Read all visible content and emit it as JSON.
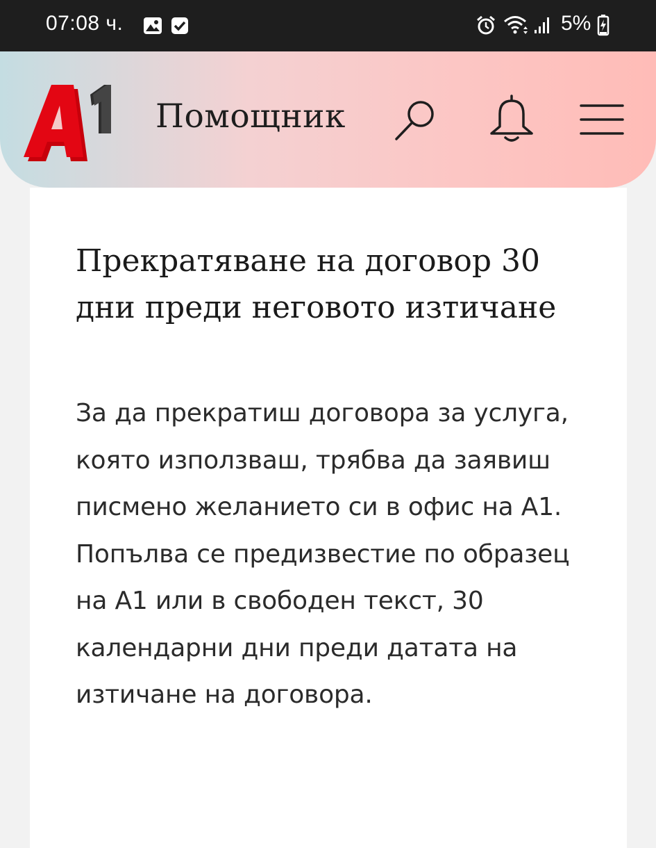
{
  "status_bar": {
    "time": "07:08 ч.",
    "battery": "5%",
    "icons": [
      "image-icon",
      "checkbox-icon",
      "alarm-icon",
      "wifi-icon",
      "signal-icon",
      "battery-charging-icon"
    ]
  },
  "header": {
    "logo_text": "A1",
    "title": "Помощник",
    "actions": [
      "search-icon",
      "bell-icon",
      "menu-icon"
    ],
    "colors": {
      "logo_red": "#e30613",
      "logo_dark": "#3a3a3a"
    }
  },
  "article": {
    "title": "Прекратяване на договор 30 дни преди неговото изтичане",
    "body": "За да прекратиш договора за услуга, която използваш, трябва да заявиш писмено желанието си в офис на А1. Попълва се предизвестие по образец на А1 или в свободен текст, 30 календарни дни преди датата на изтичане на договора."
  }
}
